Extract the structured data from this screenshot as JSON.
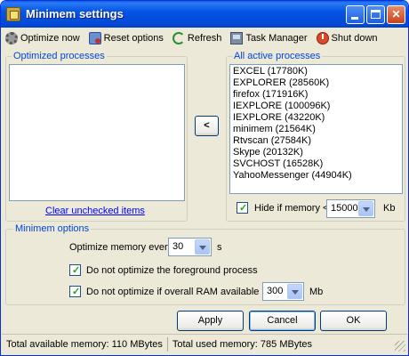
{
  "window": {
    "title": "Minimem settings",
    "controls": {
      "minimize": "",
      "maximize": "",
      "close": "✕"
    }
  },
  "toolbar": {
    "optimize_now": "Optimize now",
    "reset_options": "Reset options",
    "refresh": "Refresh",
    "task_manager": "Task Manager",
    "shut_down": "Shut down"
  },
  "optimized": {
    "label": "Optimized processes",
    "items": [],
    "clear_link": "Clear unchecked items"
  },
  "move_button": {
    "label": "<"
  },
  "active": {
    "label": "All active processes",
    "items": [
      "EXCEL (17780K)",
      "EXPLORER (28560K)",
      "firefox (171916K)",
      "IEXPLORE (100096K)",
      "IEXPLORE (43220K)",
      "minimem (21564K)",
      "Rtvscan (27584K)",
      "Skype (20132K)",
      "SVCHOST (16528K)",
      "YahooMessenger (44904K)"
    ],
    "hide_checkbox": {
      "checked": true,
      "label": "Hide if memory <"
    },
    "hide_value": "15000",
    "hide_unit": "Kb"
  },
  "options": {
    "label": "Minimem options",
    "every_label": "Optimize memory every",
    "every_value": "30",
    "every_unit": "s",
    "foreground": {
      "checked": true,
      "label": "Do not optimize the foreground process"
    },
    "ram": {
      "checked": true,
      "label": "Do not optimize if overall RAM available >"
    },
    "ram_value": "300",
    "ram_unit": "Mb"
  },
  "buttons": {
    "apply": "Apply",
    "cancel": "Cancel",
    "ok": "OK"
  },
  "status": {
    "available": "Total available memory: 110 MBytes",
    "used": "Total used memory: 785 MBytes"
  },
  "colors": {
    "titlebar": "#0553e4",
    "group_label": "#0046d5",
    "link": "#0000ff",
    "check": "#21a121"
  }
}
